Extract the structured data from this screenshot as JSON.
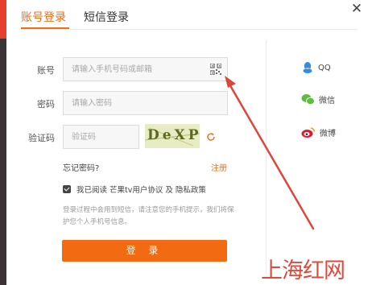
{
  "tabs": {
    "account": "账号登录",
    "sms": "短信登录"
  },
  "form": {
    "account_label": "账号",
    "account_placeholder": "请输入手机号码或邮箱",
    "password_label": "密码",
    "password_placeholder": "请输入密码",
    "captcha_label": "验证码",
    "captcha_placeholder": "验证码",
    "captcha_text": "DeXP"
  },
  "links": {
    "forgot": "忘记密码?",
    "register": "注册"
  },
  "agreement": {
    "prefix": "我已阅读",
    "user_agreement": "芒果tv用户协议",
    "and": "及",
    "privacy": "隐私政策"
  },
  "notice": "登录过程中会用到短信，请注意您的手机提示，我们将保护您个人手机号信息。",
  "login_button": "登 录",
  "social": {
    "qq": "QQ",
    "wechat": "微信",
    "weibo": "微博"
  },
  "watermark": "上海红网",
  "colors": {
    "accent": "#f06d16",
    "button": "#f26a12",
    "qq": "#2d8cf0",
    "wechat": "#5bbf3c",
    "weibo": "#e6162d",
    "annotation_arrow": "#e0453a"
  }
}
